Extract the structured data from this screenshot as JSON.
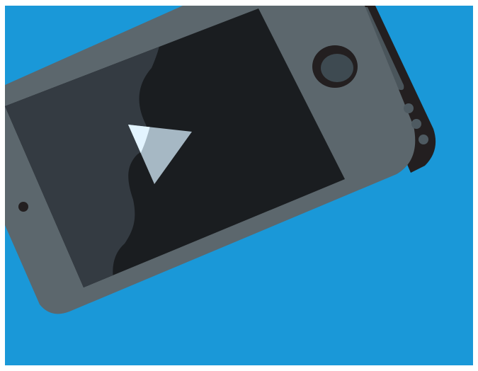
{
  "colors": {
    "background": "#1a98d8",
    "frame_white": "#ffffff",
    "phone_body": "#5c676d",
    "phone_side": "#231f20",
    "side_strip": "#4a555b",
    "screen_light": "#343b42",
    "screen_dark": "#1a1d20",
    "play_triangle": "#a6b8c4",
    "play_highlight": "#e3f4ff",
    "camera": "#3e4a51",
    "side_button": "#4e5a61"
  },
  "icons": {
    "play": "play-icon"
  }
}
